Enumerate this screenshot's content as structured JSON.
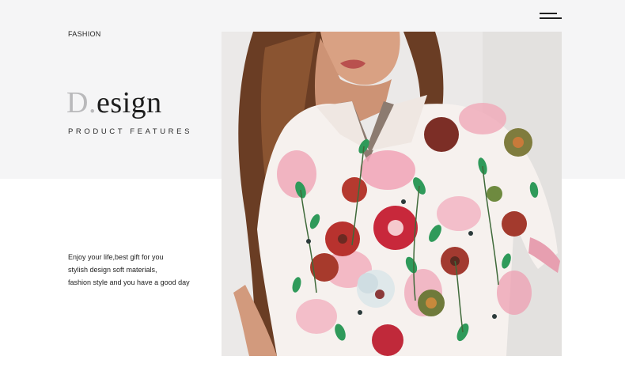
{
  "header": {
    "section_label": "FASHION",
    "menu_icon": "hamburger-menu-icon"
  },
  "hero": {
    "title_initial": "D",
    "title_dot": ".",
    "title_rest": "esign",
    "subtitle": "PRODUCT FEATURES"
  },
  "description": {
    "lines": [
      "Enjoy your life,best gift for you",
      "stylish design soft materials,",
      "fashion style and you have a good day"
    ]
  },
  "image": {
    "subject": "model-wearing-floral-print-top",
    "colors": {
      "background": "#f5f5f6",
      "shirt_base": "#f6f1ee",
      "flower_red": "#c8283b",
      "flower_pink": "#ea7d98",
      "leaf_green": "#2f9a5a",
      "hair": "#6a3d24",
      "skin": "#d9a183"
    }
  }
}
